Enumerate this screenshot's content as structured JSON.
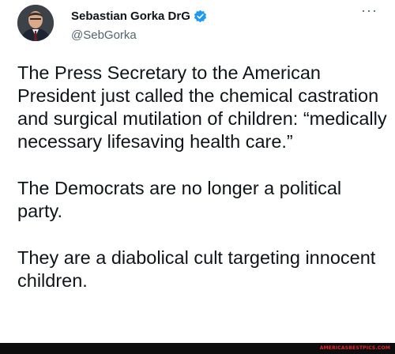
{
  "author": {
    "display_name": "Sebastian Gorka DrG",
    "handle": "@SebGorka",
    "verified": true
  },
  "menu": {
    "more_label": "···"
  },
  "tweet": {
    "paragraphs": [
      "The Press Secretary to the American President just called the chemical castration and surgical mutilation of children: “medically necessary lifesaving health care.”",
      "The Democrats are no longer a political party.",
      "They are a diabolical cult targeting innocent children."
    ]
  },
  "watermark": {
    "text": "AMERICASBESTPICS.COM"
  },
  "colors": {
    "verified_blue": "#1d9bf0",
    "watermark_red": "#e0282e"
  }
}
